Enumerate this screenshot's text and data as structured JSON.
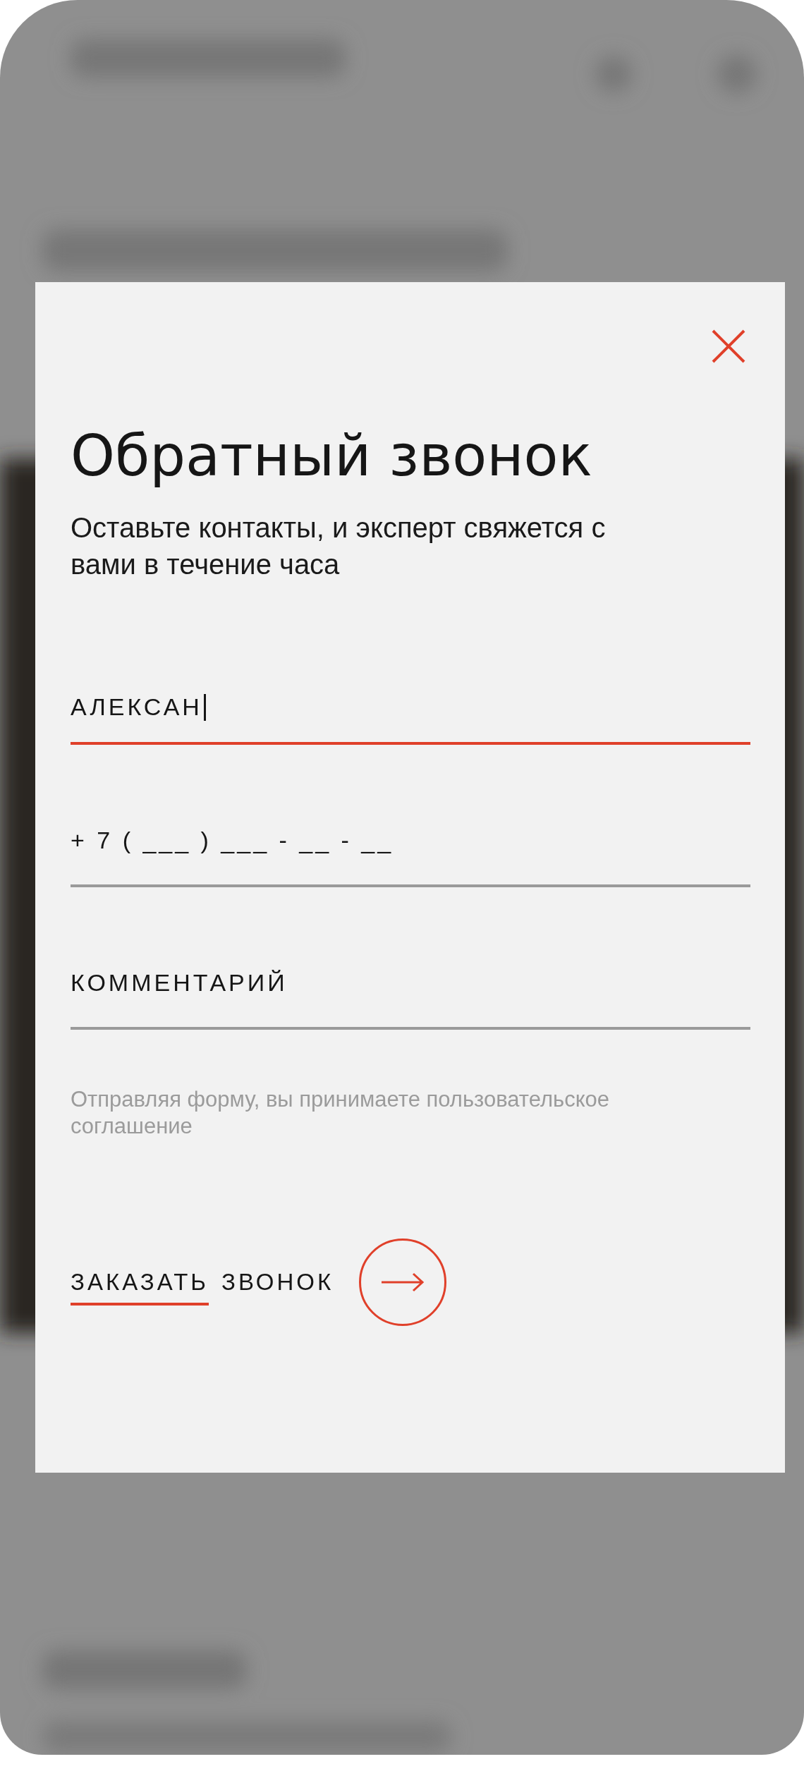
{
  "dialog": {
    "title": "Обратный звонок",
    "subtitle": "Оставьте контакты, и эксперт свяжется с вами в течение часа",
    "fields": [
      {
        "value": "АЛЕКСАН",
        "focused": true
      },
      {
        "placeholder": "+ 7 ( ___ ) ___ - __ - __",
        "focused": false
      },
      {
        "placeholder": "КОММЕНТАРИЙ",
        "focused": false
      }
    ],
    "consent": "Отправляя форму, вы принимаете пользовательское соглашение",
    "submit": {
      "parts": [
        {
          "text": "ЗАКАЗАТЬ",
          "underlined": true
        },
        {
          "text": "ЗВОНОК",
          "underlined": false
        }
      ]
    }
  }
}
